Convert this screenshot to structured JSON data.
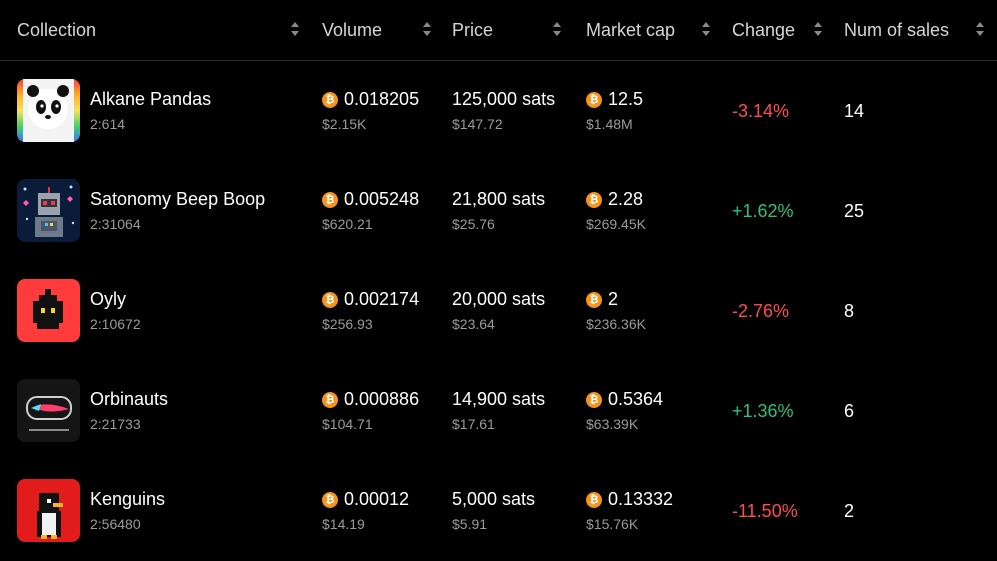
{
  "columns": {
    "collection": "Collection",
    "volume": "Volume",
    "price": "Price",
    "market_cap": "Market cap",
    "change": "Change",
    "num_sales": "Num of sales"
  },
  "coin_symbol": "₿",
  "rows": [
    {
      "name": "Alkane Pandas",
      "id": "2:614",
      "volume_btc": "0.018205",
      "volume_usd": "$2.15K",
      "price_sats": "125,000 sats",
      "price_usd": "$147.72",
      "market_cap_btc": "12.5",
      "market_cap_usd": "$1.48M",
      "change": "-3.14%",
      "num_sales": "14"
    },
    {
      "name": "Satonomy Beep Boop",
      "id": "2:31064",
      "volume_btc": "0.005248",
      "volume_usd": "$620.21",
      "price_sats": "21,800 sats",
      "price_usd": "$25.76",
      "market_cap_btc": "2.28",
      "market_cap_usd": "$269.45K",
      "change": "+1.62%",
      "num_sales": "25"
    },
    {
      "name": "Oyly",
      "id": "2:10672",
      "volume_btc": "0.002174",
      "volume_usd": "$256.93",
      "price_sats": "20,000 sats",
      "price_usd": "$23.64",
      "market_cap_btc": "2",
      "market_cap_usd": "$236.36K",
      "change": "-2.76%",
      "num_sales": "8"
    },
    {
      "name": "Orbinauts",
      "id": "2:21733",
      "volume_btc": "0.000886",
      "volume_usd": "$104.71",
      "price_sats": "14,900 sats",
      "price_usd": "$17.61",
      "market_cap_btc": "0.5364",
      "market_cap_usd": "$63.39K",
      "change": "+1.36%",
      "num_sales": "6"
    },
    {
      "name": "Kenguins",
      "id": "2:56480",
      "volume_btc": "0.00012",
      "volume_usd": "$14.19",
      "price_sats": "5,000 sats",
      "price_usd": "$5.91",
      "market_cap_btc": "0.13332",
      "market_cap_usd": "$15.76K",
      "change": "-11.50%",
      "num_sales": "2"
    }
  ],
  "colors": {
    "negative": "#ff4d4f",
    "positive": "#29c37a",
    "coin": "#f7931a"
  }
}
